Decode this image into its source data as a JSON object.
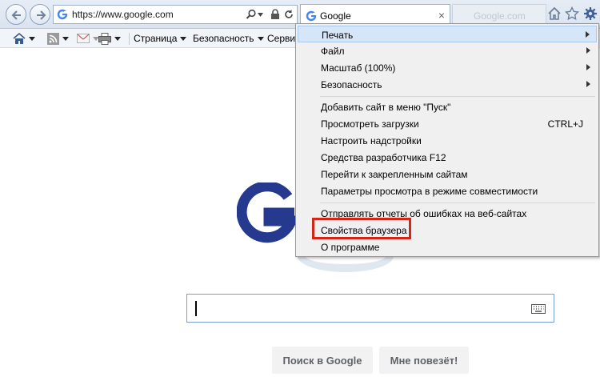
{
  "address": {
    "url": "https://www.google.com"
  },
  "tab": {
    "title": "Google",
    "close": "×"
  },
  "newtab": {
    "label": "Google.com"
  },
  "commandbar": {
    "page_label": "Страница",
    "security_label": "Безопасность",
    "service_label": "Серви"
  },
  "page": {
    "search_button": "Поиск в Google",
    "lucky_button": "Мне повезёт!"
  },
  "menu": {
    "items": [
      {
        "label": "Печать",
        "submenu": true
      },
      {
        "label": "Файл",
        "submenu": true
      },
      {
        "label": "Масштаб (100%)",
        "submenu": true
      },
      {
        "label": "Безопасность",
        "submenu": true
      },
      {
        "label": "Добавить сайт в меню \"Пуск\""
      },
      {
        "label": "Просмотреть загрузки",
        "shortcut": "CTRL+J"
      },
      {
        "label": "Настроить надстройки"
      },
      {
        "label": "Средства разработчика F12"
      },
      {
        "label": "Перейти к закрепленным сайтам"
      },
      {
        "label": "Параметры просмотра в режиме совместимости"
      },
      {
        "label": "Отправлять отчеты об ошибках на веб-сайтах"
      },
      {
        "label": "Свойства браузера"
      },
      {
        "label": "О программе"
      }
    ]
  },
  "colors": {
    "highlight_box": "#d62417",
    "google_blue": "#253a8e",
    "menu_highlight": "#d6e6f9"
  }
}
